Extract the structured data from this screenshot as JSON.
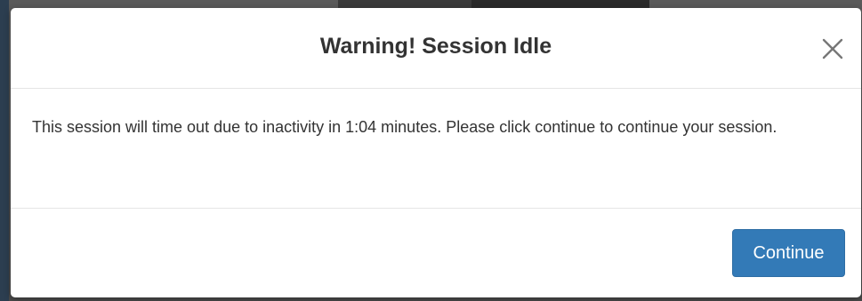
{
  "modal": {
    "title": "Warning! Session Idle",
    "message": "This session will time out due to inactivity in 1:04 minutes. Please click continue to continue your session.",
    "close_icon": "close-icon",
    "continue_label": "Continue"
  },
  "colors": {
    "primary_button": "#337ab7",
    "title_text": "#333333",
    "divider": "#e5e5e5"
  }
}
